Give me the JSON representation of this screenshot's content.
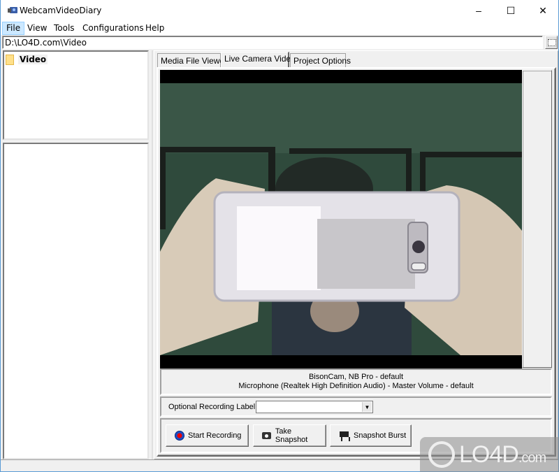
{
  "window": {
    "title": "WebcamVideoDiary",
    "controls": {
      "minimize": "–",
      "maximize": "☐",
      "close": "✕"
    }
  },
  "menu": {
    "items": [
      {
        "label": "File",
        "active": true
      },
      {
        "label": "View"
      },
      {
        "label": "Tools"
      },
      {
        "label": "Configurations"
      },
      {
        "label": "Help"
      }
    ]
  },
  "path": {
    "value": "D:\\LO4D.com\\Video"
  },
  "tree": {
    "items": [
      {
        "label": "Video",
        "icon": "folder-icon"
      }
    ]
  },
  "tabs": [
    {
      "label": "Media File Viewer"
    },
    {
      "label": "Live Camera Video",
      "active": true
    },
    {
      "label": "Project Options"
    }
  ],
  "devices": {
    "video": "BisonCam, NB Pro - default",
    "audio": "Microphone (Realtek High Definition Audio) - Master Volume - default"
  },
  "recording_label": {
    "label": "Optional Recording Label:",
    "value": ""
  },
  "buttons": {
    "start_recording": "Start Recording",
    "take_snapshot": "Take Snapshot",
    "snapshot_burst": "Snapshot Burst"
  },
  "watermark": {
    "main": "LO4D",
    "suffix": ".com"
  }
}
